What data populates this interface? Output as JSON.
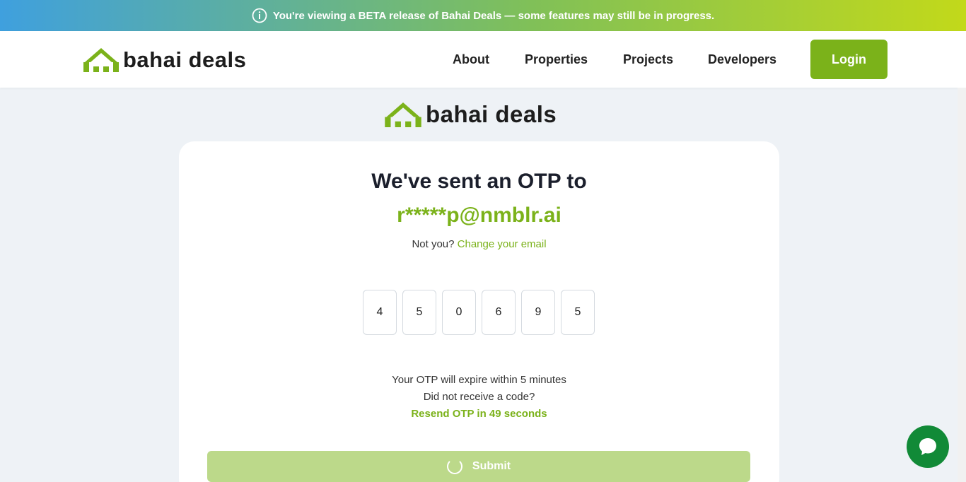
{
  "banner": {
    "text": "You're viewing a BETA release of Bahai Deals — some features may still be in progress."
  },
  "header": {
    "logo_text": "bahai deals",
    "nav": [
      "About",
      "Properties",
      "Projects",
      "Developers"
    ],
    "login_label": "Login"
  },
  "center_logo_text": "bahai deals",
  "otp": {
    "heading": "We've sent an OTP to",
    "email": "r*****p@nmblr.ai",
    "not_you": "Not you?",
    "change_email": "Change your email",
    "digits": [
      "4",
      "5",
      "0",
      "6",
      "9",
      "5"
    ],
    "expire": "Your OTP will expire within 5 minutes",
    "no_code": "Did not receive a code?",
    "resend": "Resend OTP in 49 seconds",
    "submit_label": "Submit"
  },
  "colors": {
    "brand_green": "#7bb21a",
    "submit_disabled": "#bcd98a",
    "chat_green": "#118a37"
  },
  "icons": [
    "info-icon",
    "logo-house-icon",
    "spinner-icon",
    "chat-icon"
  ]
}
